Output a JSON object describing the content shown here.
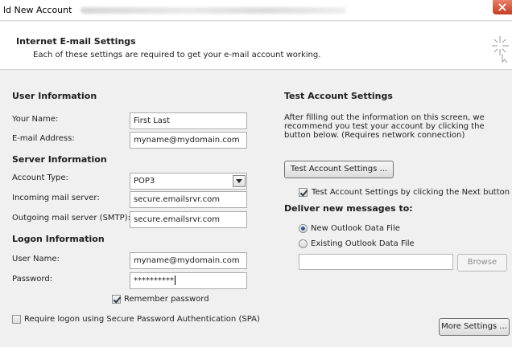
{
  "window": {
    "title": "ld New Account"
  },
  "header": {
    "title": "Internet E-mail Settings",
    "subtitle": "Each of these settings are required to get your e-mail account working."
  },
  "user_info": {
    "heading": "User Information",
    "name_label": "Your Name:",
    "name_value": "First Last",
    "email_label": "E-mail Address:",
    "email_value": "myname@mydomain.com"
  },
  "server_info": {
    "heading": "Server Information",
    "account_type_label": "Account Type:",
    "account_type_value": "POP3",
    "incoming_label": "Incoming mail server:",
    "incoming_value": "secure.emailsrvr.com",
    "outgoing_label": "Outgoing mail server (SMTP):",
    "outgoing_value": "secure.emailsrvr.com"
  },
  "logon_info": {
    "heading": "Logon Information",
    "username_label": "User Name:",
    "username_value": "myname@mydomain.com",
    "password_label": "Password:",
    "password_value": "**********",
    "remember_label": "Remember password",
    "remember_checked": true,
    "spa_label": "Require logon using Secure Password Authentication (SPA)",
    "spa_checked": false
  },
  "test_settings": {
    "heading": "Test Account Settings",
    "description": "After filling out the information on this screen, we recommend you test your account by clicking the button below. (Requires network connection)",
    "test_button": "Test Account Settings ...",
    "auto_test_label": "Test Account Settings by clicking the Next button",
    "auto_test_checked": true
  },
  "deliver": {
    "heading": "Deliver new messages to:",
    "new_file_label": "New Outlook Data File",
    "existing_file_label": "Existing Outlook Data File",
    "selected": "new",
    "path_value": "",
    "browse_button": "Browse"
  },
  "more_settings_button": "More Settings ...",
  "colors": {
    "close": "#c63c22",
    "radio_dot": "#2c5a9a",
    "check": "#2b3a4f"
  }
}
